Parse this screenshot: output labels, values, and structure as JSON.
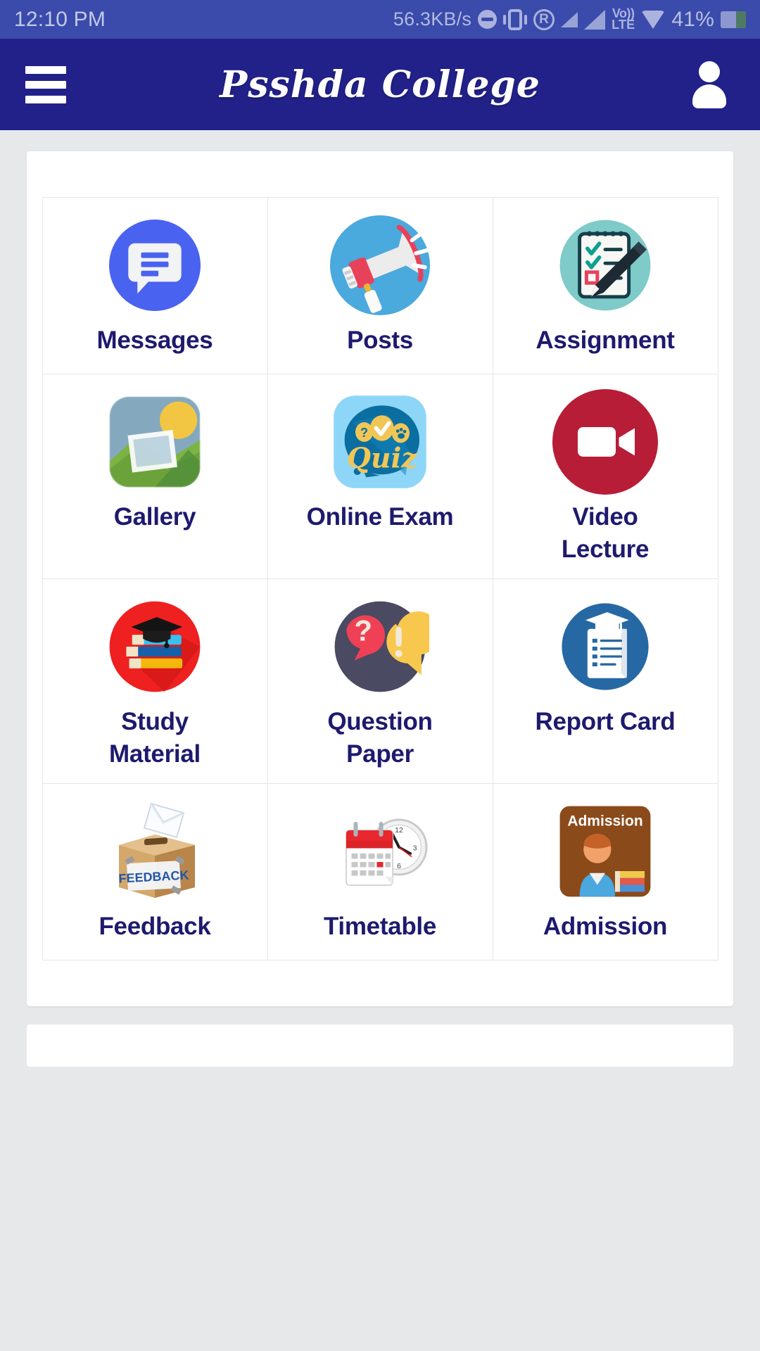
{
  "status_bar": {
    "time": "12:10 PM",
    "network_speed": "56.3KB/s",
    "dnd_icon": "do-not-disturb-icon",
    "vibrate_icon": "vibrate-icon",
    "roaming_icon": "R",
    "signal_icon": "signal-bars-icon",
    "volte_line1": "Vo))",
    "volte_line2": "LTE",
    "wifi_icon": "wifi-icon",
    "battery_percent": "41%",
    "battery_icon": "battery-icon"
  },
  "app_bar": {
    "menu_icon": "hamburger-menu-icon",
    "title": "Psshda College",
    "profile_icon": "user-profile-icon"
  },
  "colors": {
    "status_bar_bg": "#3a4bab",
    "app_bar_bg": "#22218a",
    "page_bg": "#e7e8ea",
    "label_text": "#1e1a6e",
    "card_bg": "#ffffff",
    "tile_border": "#e6e6e6"
  },
  "menu_grid": {
    "tiles": [
      {
        "id": "messages",
        "label": "Messages",
        "icon": "messages-chat-bubble-icon"
      },
      {
        "id": "posts",
        "label": "Posts",
        "icon": "megaphone-announcement-icon"
      },
      {
        "id": "assignment",
        "label": "Assignment",
        "icon": "clipboard-checklist-pencil-icon"
      },
      {
        "id": "gallery",
        "label": "Gallery",
        "icon": "photo-gallery-icon"
      },
      {
        "id": "online-exam",
        "label": "Online Exam",
        "icon": "quiz-icon",
        "icon_text": "Quiz"
      },
      {
        "id": "video-lecture",
        "label": "Video\nLecture",
        "icon": "video-camera-icon"
      },
      {
        "id": "study-material",
        "label": "Study\nMaterial",
        "icon": "books-graduation-cap-icon"
      },
      {
        "id": "question-paper",
        "label": "Question\nPaper",
        "icon": "question-exclamation-bubbles-icon"
      },
      {
        "id": "report-card",
        "label": "Report Card",
        "icon": "report-card-document-icon"
      },
      {
        "id": "feedback",
        "label": "Feedback",
        "icon": "feedback-box-icon",
        "icon_text": "FEEDBACK"
      },
      {
        "id": "timetable",
        "label": "Timetable",
        "icon": "calendar-clock-icon"
      },
      {
        "id": "admission",
        "label": "Admission",
        "icon": "admission-student-icon",
        "icon_text": "Admission"
      }
    ]
  }
}
